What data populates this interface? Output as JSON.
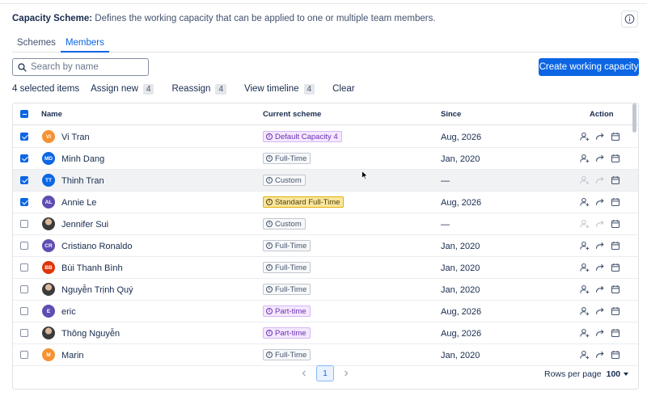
{
  "header": {
    "title": "Capacity Scheme:",
    "description": " Defines the working capacity that can be applied to one or multiple team members."
  },
  "tabs": [
    {
      "label": "Schemes",
      "active": false
    },
    {
      "label": "Members",
      "active": true
    }
  ],
  "search": {
    "placeholder": "Search by name",
    "value": ""
  },
  "create_button": "Create working capacity",
  "bulk": {
    "selected_text": "4 selected items",
    "actions": [
      {
        "label": "Assign new",
        "count": "4"
      },
      {
        "label": "Reassign",
        "count": "4"
      },
      {
        "label": "View timeline",
        "count": "4"
      }
    ],
    "clear": "Clear"
  },
  "columns": {
    "name": "Name",
    "scheme": "Current scheme",
    "since": "Since",
    "action": "Action"
  },
  "colors": {
    "accent": "#0c66e4",
    "purple_badge": "#f3e8fd",
    "yellow_badge": "#f8e6a0"
  },
  "rows": [
    {
      "name": "Vi Tran",
      "initials": "VI",
      "avatar_color": "#f79232",
      "scheme": "Default Capacity 4",
      "scheme_style": "purple",
      "since": "Aug, 2026",
      "checked": true,
      "hover": false,
      "actions_enabled": true
    },
    {
      "name": "Minh Dang",
      "initials": "MD",
      "avatar_color": "#0c66e4",
      "scheme": "Full-Time",
      "scheme_style": "default",
      "since": "Jan, 2020",
      "checked": true,
      "hover": false,
      "actions_enabled": true
    },
    {
      "name": "Thinh Tran",
      "initials": "TT",
      "avatar_color": "#0c66e4",
      "scheme": "Custom",
      "scheme_style": "default",
      "since": "—",
      "checked": true,
      "hover": true,
      "actions_enabled": false
    },
    {
      "name": "Annie Le",
      "initials": "AL",
      "avatar_color": "#5e4db2",
      "scheme": "Standard Full-Time",
      "scheme_style": "yellow",
      "since": "Aug, 2026",
      "checked": true,
      "hover": false,
      "actions_enabled": true
    },
    {
      "name": "Jennifer Sui",
      "initials": "",
      "avatar_color": "photo",
      "scheme": "Custom",
      "scheme_style": "default",
      "since": "—",
      "checked": false,
      "hover": false,
      "actions_enabled": false
    },
    {
      "name": "Cristiano Ronaldo",
      "initials": "CR",
      "avatar_color": "#5e4db2",
      "scheme": "Full-Time",
      "scheme_style": "default",
      "since": "Jan, 2020",
      "checked": false,
      "hover": false,
      "actions_enabled": true
    },
    {
      "name": "Bùi Thanh Bình",
      "initials": "BB",
      "avatar_color": "#de350b",
      "scheme": "Full-Time",
      "scheme_style": "default",
      "since": "Jan, 2020",
      "checked": false,
      "hover": false,
      "actions_enabled": true
    },
    {
      "name": "Nguyễn Trịnh Quý",
      "initials": "",
      "avatar_color": "photo",
      "scheme": "Full-Time",
      "scheme_style": "default",
      "since": "Jan, 2020",
      "checked": false,
      "hover": false,
      "actions_enabled": true
    },
    {
      "name": "eric",
      "initials": "E",
      "avatar_color": "#5e4db2",
      "scheme": "Part-time",
      "scheme_style": "purple",
      "since": "Aug, 2026",
      "checked": false,
      "hover": false,
      "actions_enabled": true
    },
    {
      "name": "Thông Nguyễn",
      "initials": "",
      "avatar_color": "photo",
      "scheme": "Part-time",
      "scheme_style": "purple",
      "since": "Aug, 2026",
      "checked": false,
      "hover": false,
      "actions_enabled": true
    },
    {
      "name": "Marin",
      "initials": "M",
      "avatar_color": "#f79232",
      "scheme": "Full-Time",
      "scheme_style": "default",
      "since": "Jan, 2020",
      "checked": false,
      "hover": false,
      "actions_enabled": true
    }
  ],
  "pagination": {
    "current_page": "1"
  },
  "rows_per_page": {
    "label": "Rows per page",
    "value": "100"
  }
}
